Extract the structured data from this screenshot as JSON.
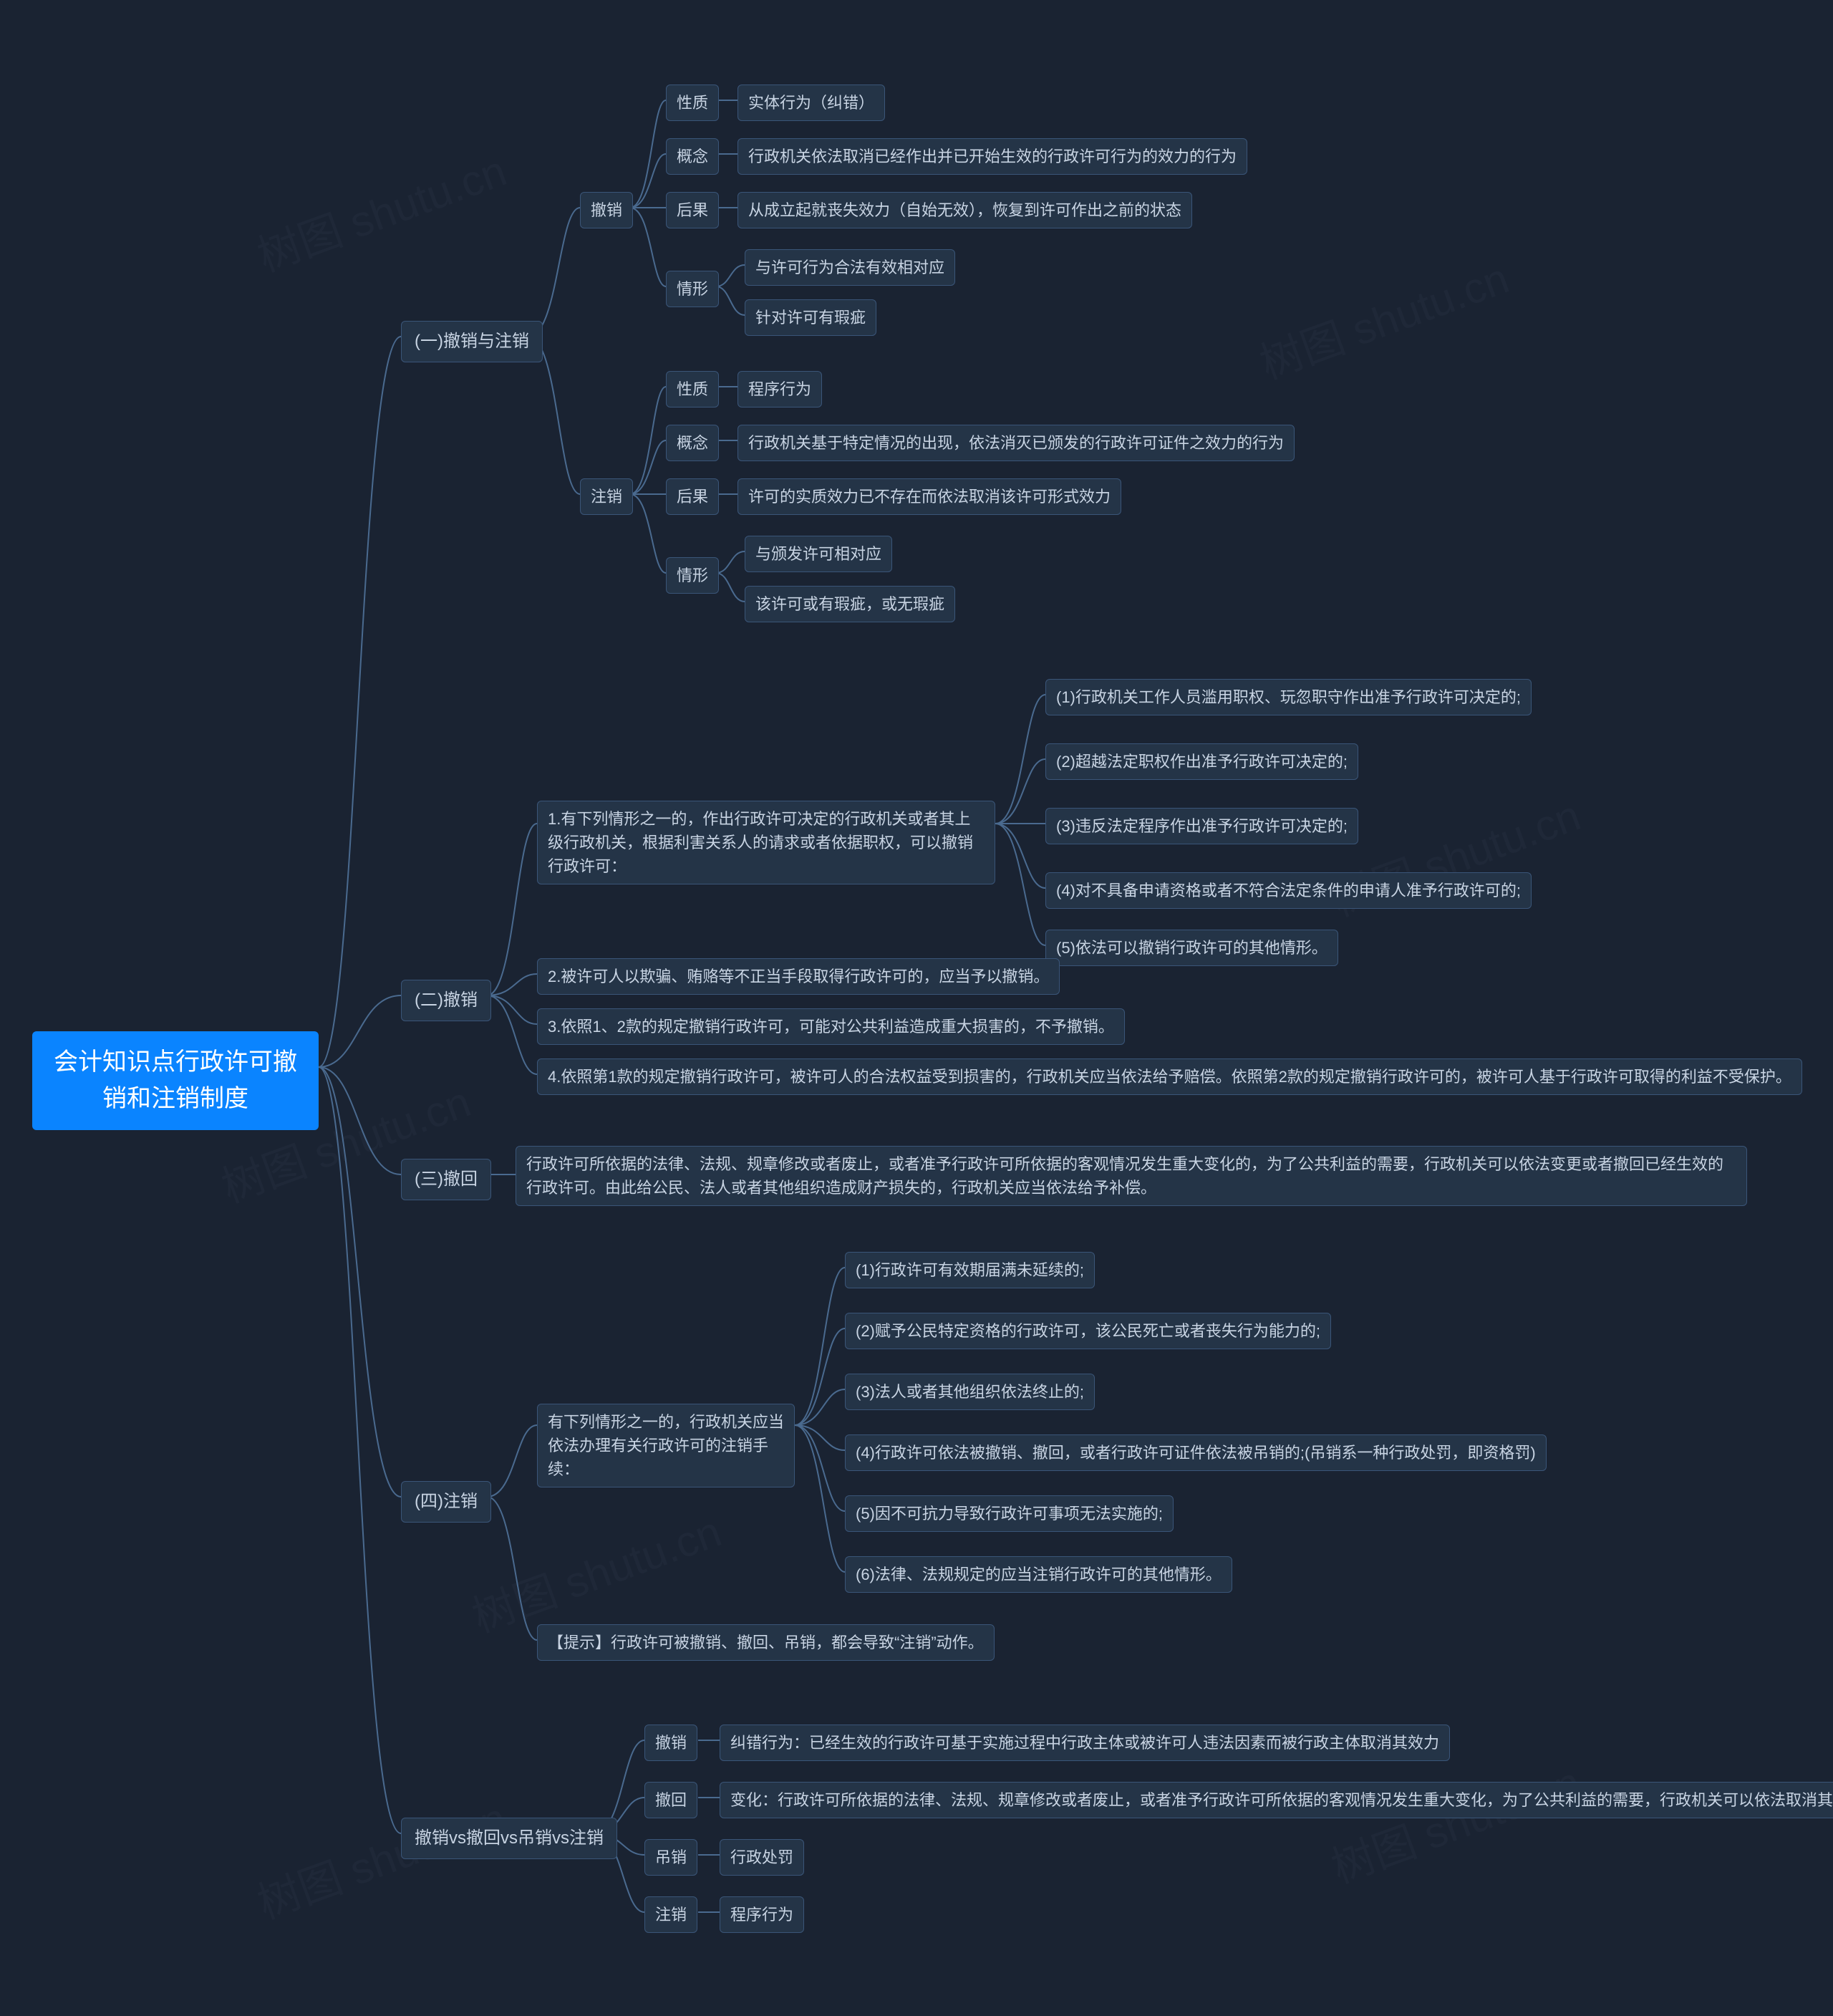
{
  "watermark": "树图 shutu.cn",
  "root": "会计知识点行政许可撤销和注销制度",
  "sections": {
    "s1": {
      "title": "(一)撤销与注销",
      "chexiao": {
        "label": "撤销",
        "xingzhi": {
          "label": "性质",
          "value": "实体行为（纠错）"
        },
        "gainian": {
          "label": "概念",
          "value": "行政机关依法取消已经作出并已开始生效的行政许可行为的效力的行为"
        },
        "houguo": {
          "label": "后果",
          "value": "从成立起就丧失效力（自始无效），恢复到许可作出之前的状态"
        },
        "qingxing": {
          "label": "情形",
          "items": [
            "与许可行为合法有效相对应",
            "针对许可有瑕疵"
          ]
        }
      },
      "zhuxiao": {
        "label": "注销",
        "xingzhi": {
          "label": "性质",
          "value": "程序行为"
        },
        "gainian": {
          "label": "概念",
          "value": "行政机关基于特定情况的出现，依法消灭已颁发的行政许可证件之效力的行为"
        },
        "houguo": {
          "label": "后果",
          "value": "许可的实质效力已不存在而依法取消该许可形式效力"
        },
        "qingxing": {
          "label": "情形",
          "items": [
            "与颁发许可相对应",
            "该许可或有瑕疵，或无瑕疵"
          ]
        }
      }
    },
    "s2": {
      "title": "(二)撤销",
      "p1": {
        "text": "1.有下列情形之一的，作出行政许可决定的行政机关或者其上级行政机关，根据利害关系人的请求或者依据职权，可以撤销行政许可：",
        "items": [
          "(1)行政机关工作人员滥用职权、玩忽职守作出准予行政许可决定的;",
          "(2)超越法定职权作出准予行政许可决定的;",
          "(3)违反法定程序作出准予行政许可决定的;",
          "(4)对不具备申请资格或者不符合法定条件的申请人准予行政许可的;",
          "(5)依法可以撤销行政许可的其他情形。"
        ]
      },
      "p2": "2.被许可人以欺骗、贿赂等不正当手段取得行政许可的，应当予以撤销。",
      "p3": "3.依照1、2款的规定撤销行政许可，可能对公共利益造成重大损害的，不予撤销。",
      "p4": "4.依照第1款的规定撤销行政许可，被许可人的合法权益受到损害的，行政机关应当依法给予赔偿。依照第2款的规定撤销行政许可的，被许可人基于行政许可取得的利益不受保护。"
    },
    "s3": {
      "title": "(三)撤回",
      "text": "行政许可所依据的法律、法规、规章修改或者废止，或者准予行政许可所依据的客观情况发生重大变化的，为了公共利益的需要，行政机关可以依法变更或者撤回已经生效的行政许可。由此给公民、法人或者其他组织造成财产损失的，行政机关应当依法给予补偿。"
    },
    "s4": {
      "title": "(四)注销",
      "lead": "有下列情形之一的，行政机关应当依法办理有关行政许可的注销手续：",
      "items": [
        "(1)行政许可有效期届满未延续的;",
        "(2)赋予公民特定资格的行政许可，该公民死亡或者丧失行为能力的;",
        "(3)法人或者其他组织依法终止的;",
        "(4)行政许可依法被撤销、撤回，或者行政许可证件依法被吊销的;(吊销系一种行政处罚，即资格罚)",
        "(5)因不可抗力导致行政许可事项无法实施的;",
        "(6)法律、法规规定的应当注销行政许可的其他情形。"
      ],
      "tip": "【提示】行政许可被撤销、撤回、吊销，都会导致“注销”动作。"
    },
    "s5": {
      "title": "撤销vs撤回vs吊销vs注销",
      "chexiao": {
        "label": "撤销",
        "value": "纠错行为：已经生效的行政许可基于实施过程中行政主体或被许可人违法因素而被行政主体取消其效力"
      },
      "chehui": {
        "label": "撤回",
        "value": "变化：行政许可所依据的法律、法规、规章修改或者废止，或者准予行政许可所依据的客观情况发生重大变化，为了公共利益的需要，行政机关可以依法取消其效力"
      },
      "diaoxiao": {
        "label": "吊销",
        "value": "行政处罚"
      },
      "zhuxiao": {
        "label": "注销",
        "value": "程序行为"
      }
    }
  }
}
